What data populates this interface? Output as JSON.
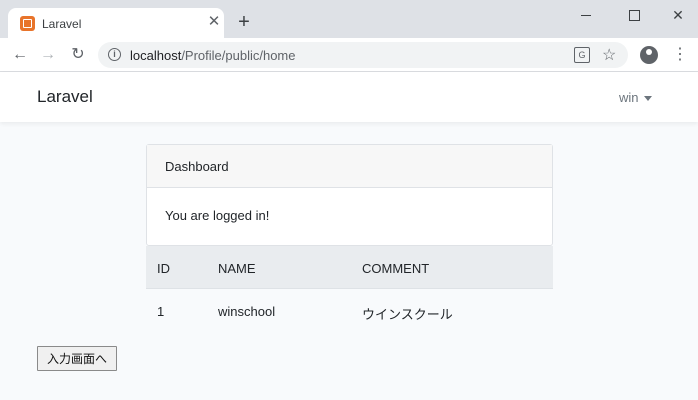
{
  "browser": {
    "tab_title": "Laravel",
    "tab_close": "✕",
    "new_tab": "+",
    "url_host": "localhost",
    "url_path": "/Profile/public/home",
    "icons": {
      "back": "←",
      "forward": "→",
      "reload": "↻",
      "info": "i",
      "star": "☆",
      "menu": "⋮",
      "translate": "G"
    }
  },
  "navbar": {
    "brand": "Laravel",
    "user": "win"
  },
  "card": {
    "header": "Dashboard",
    "body": "You are logged in!"
  },
  "table": {
    "columns": [
      "ID",
      "NAME",
      "COMMENT"
    ],
    "rows": [
      [
        "1",
        "winschool",
        "ウインスクール"
      ]
    ]
  },
  "actions": {
    "input_button": "入力画面へ"
  },
  "colors": {
    "background": "#f8fafc",
    "table_header": "#e9ecef",
    "favicon": "#e8742b"
  }
}
